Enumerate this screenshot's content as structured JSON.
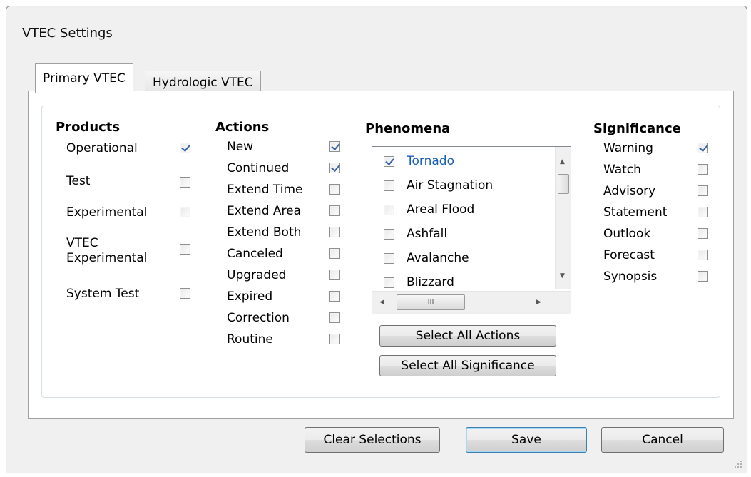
{
  "window": {
    "title": "VTEC Settings"
  },
  "tabs": [
    {
      "label": "Primary VTEC",
      "active": true
    },
    {
      "label": "Hydrologic VTEC",
      "active": false
    }
  ],
  "products": {
    "heading": "Products",
    "items": [
      {
        "label": "Operational",
        "checked": true
      },
      {
        "label": "Test",
        "checked": false
      },
      {
        "label": "Experimental",
        "checked": false
      },
      {
        "label_line1": "VTEC",
        "label_line2": "Experimental",
        "checked": false
      },
      {
        "label": "System Test",
        "checked": false
      }
    ]
  },
  "actions": {
    "heading": "Actions",
    "items": [
      {
        "label": "New",
        "checked": true
      },
      {
        "label": "Continued",
        "checked": true
      },
      {
        "label": "Extend Time",
        "checked": false
      },
      {
        "label": "Extend Area",
        "checked": false
      },
      {
        "label": "Extend Both",
        "checked": false
      },
      {
        "label": "Canceled",
        "checked": false
      },
      {
        "label": "Upgraded",
        "checked": false
      },
      {
        "label": "Expired",
        "checked": false
      },
      {
        "label": "Correction",
        "checked": false
      },
      {
        "label": "Routine",
        "checked": false
      }
    ]
  },
  "phenomena": {
    "heading": "Phenomena",
    "items": [
      {
        "label": "Tornado",
        "checked": true,
        "selected": true
      },
      {
        "label": "Air Stagnation",
        "checked": false
      },
      {
        "label": "Areal Flood",
        "checked": false
      },
      {
        "label": "Ashfall",
        "checked": false
      },
      {
        "label": "Avalanche",
        "checked": false
      },
      {
        "label": "Blizzard",
        "checked": false
      }
    ],
    "select_all_actions": "Select All Actions",
    "select_all_significance": "Select All Significance"
  },
  "significance": {
    "heading": "Significance",
    "items": [
      {
        "label": "Warning",
        "checked": true
      },
      {
        "label": "Watch",
        "checked": false
      },
      {
        "label": "Advisory",
        "checked": false
      },
      {
        "label": "Statement",
        "checked": false
      },
      {
        "label": "Outlook",
        "checked": false
      },
      {
        "label": "Forecast",
        "checked": false
      },
      {
        "label": "Synopsis",
        "checked": false
      }
    ]
  },
  "footer": {
    "clear": "Clear Selections",
    "save": "Save",
    "cancel": "Cancel"
  },
  "icons": {
    "scroll_up": "triangle-up",
    "scroll_down": "triangle-down",
    "scroll_left": "triangle-left",
    "scroll_right": "triangle-right",
    "thumb_grip": "III",
    "check_color": "#3b63a8"
  }
}
